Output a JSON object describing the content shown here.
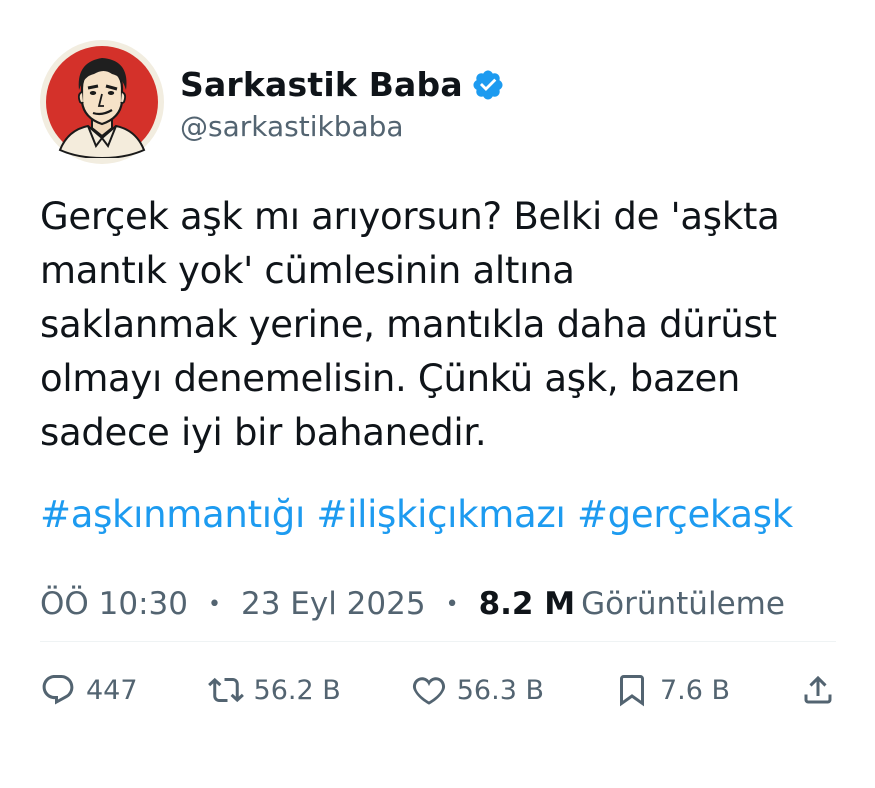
{
  "author": {
    "display_name": "Sarkastik Baba",
    "handle": "@sarkastikbaba",
    "verified": true,
    "avatar_icon": "man-portrait-avatar-icon",
    "verified_icon": "verified-badge-icon",
    "colors": {
      "badge": "#1d9bf0",
      "avatar_bg": "#d4312a"
    }
  },
  "tweet": {
    "text": "Gerçek aşk mı arıyorsun? Belki de 'aşkta\nmantık yok' cümlesinin altına\nsaklanmak yerine, mantıkla daha dürüst\nolmayı denemelisin. Çünkü aşk, bazen\nsadece iyi bir bahanedir.",
    "hashtags": [
      "#aşkınmantığı",
      "#ilişkiçıkmazı",
      "#gerçekaşk"
    ]
  },
  "meta": {
    "time": "ÖÖ 10:30",
    "date": "23 Eyl 2025",
    "views_count": "8.2 M",
    "views_label": "Görüntüleme",
    "separator": "•"
  },
  "actions": {
    "replies": {
      "icon": "reply-icon",
      "count": "447"
    },
    "retweets": {
      "icon": "retweet-icon",
      "count": "56.2 B"
    },
    "likes": {
      "icon": "heart-icon",
      "count": "56.3 B"
    },
    "bookmarks": {
      "icon": "bookmark-icon",
      "count": "7.6 B"
    },
    "share": {
      "icon": "share-icon"
    }
  },
  "colors": {
    "text": "#0f1419",
    "secondary": "#536471",
    "link": "#1d9bf0",
    "divider": "#eff3f4"
  }
}
